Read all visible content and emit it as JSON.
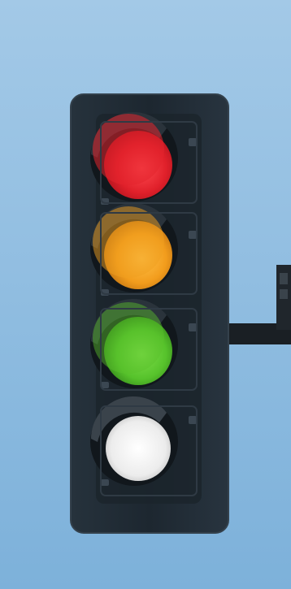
{
  "colors": {
    "sky_top": "#9cc6e6",
    "sky_bottom": "#7fb4dc",
    "housing": "#1f2a33",
    "housing_edge": "#2d3a45",
    "arm": "#1a1f24",
    "red_lens": "#e5262e",
    "amber_lens": "#f3a220",
    "green_lens": "#5cc82f",
    "white_lens": "#f2f2f2"
  },
  "signal": {
    "lamps": [
      {
        "color": "red",
        "state": "lit"
      },
      {
        "color": "amber",
        "state": "lit"
      },
      {
        "color": "green",
        "state": "lit"
      },
      {
        "color": "white",
        "state": "lit"
      }
    ]
  }
}
